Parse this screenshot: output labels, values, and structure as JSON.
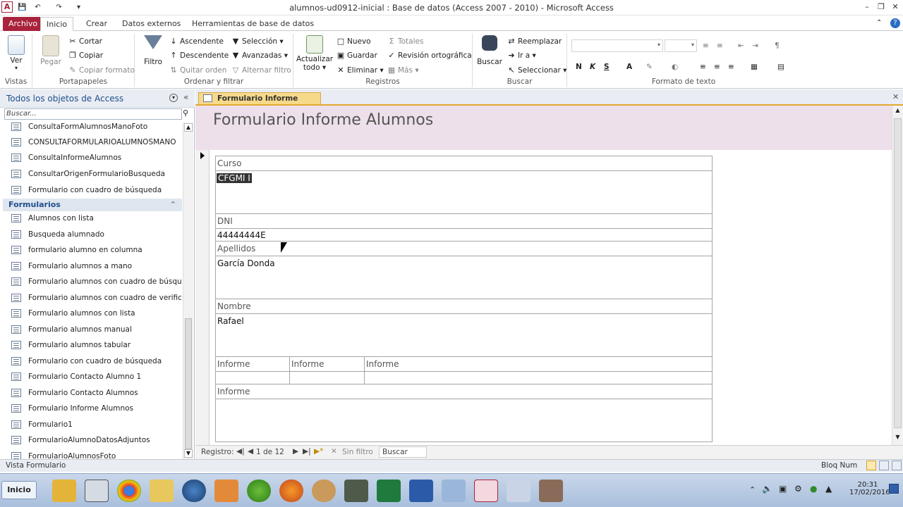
{
  "window": {
    "title": "alumnos-ud0912-inicial : Base de datos (Access 2007 - 2010)  -  Microsoft Access",
    "app_icon": "A",
    "controls": [
      "minimize-icon",
      "restore-icon",
      "close-icon"
    ]
  },
  "ribbon_tabs": [
    "Archivo",
    "Inicio",
    "Crear",
    "Datos externos",
    "Herramientas de base de datos"
  ],
  "ribbon": {
    "vistas": {
      "ver_label": "Ver",
      "group_label": "Vistas"
    },
    "portapapeles": {
      "pegar": "Pegar",
      "cortar": "Cortar",
      "copiar": "Copiar",
      "copiar_formato": "Copiar formato",
      "group_label": "Portapapeles"
    },
    "ordenar": {
      "filtro": "Filtro",
      "ascendente": "Ascendente",
      "descendente": "Descendente",
      "quitar_orden": "Quitar orden",
      "seleccion": "Selección",
      "avanzadas": "Avanzadas",
      "alternar_filtro": "Alternar filtro",
      "group_label": "Ordenar y filtrar"
    },
    "registros": {
      "actualizar_line1": "Actualizar",
      "actualizar_line2": "todo",
      "nuevo": "Nuevo",
      "guardar": "Guardar",
      "eliminar": "Eliminar",
      "totales": "Totales",
      "revision": "Revisión ortográfica",
      "mas": "Más",
      "group_label": "Registros"
    },
    "buscar": {
      "buscar": "Buscar",
      "reemplazar": "Reemplazar",
      "ir_a": "Ir a",
      "seleccionar": "Seleccionar",
      "group_label": "Buscar"
    },
    "formato": {
      "bold": "N",
      "italic": "K",
      "underline": "S",
      "group_label": "Formato de texto"
    }
  },
  "nav": {
    "title": "Todos los objetos de Access",
    "search_placeholder": "Buscar...",
    "queries": [
      "ConsultaFormAlumnosManoFoto",
      "CONSULTAFORMULARIOALUMNOSMANO",
      "ConsultaInformeAlumnos",
      "ConsultarOrigenFormularioBusqueda",
      "Formulario con cuadro de búsqueda"
    ],
    "group_label": "Formularios",
    "forms": [
      "Alumnos con lista",
      "Busqueda alumnado",
      "formulario alumno en columna",
      "Formulario alumnos a mano",
      "Formulario alumnos con cuadro de búsque...",
      "Formulario alumnos con cuadro de verific...",
      "Formulario alumnos con lista",
      "Formulario alumnos manual",
      "Formulario alumnos tabular",
      "Formulario con cuadro de búsqueda",
      "Formulario Contacto Alumno 1",
      "Formulario Contacto Alumnos",
      "Formulario Informe Alumnos",
      "Formulario1",
      "FormularioAlumnoDatosAdjuntos",
      "FormularioAlumnosFoto"
    ]
  },
  "document": {
    "tab_label": "Formulario Informe Alumnos",
    "form_title": "Formulario Informe Alumnos",
    "fields": {
      "curso_label": "Curso",
      "curso_value": "CFGMI I",
      "dni_label": "DNI",
      "dni_value": "44444444E",
      "apellidos_label": "Apellidos",
      "apellidos_value": "García Donda",
      "nombre_label": "Nombre",
      "nombre_value": "Rafael",
      "informe_cols": [
        "Informe",
        "Informe",
        "Informe"
      ],
      "informe_label": "Informe"
    }
  },
  "record_nav": {
    "label": "Registro:",
    "position": "1 de 12",
    "filter": "Sin filtro",
    "search": "Buscar"
  },
  "status": {
    "left": "Vista Formulario",
    "right": "Bloq Num"
  },
  "taskbar": {
    "start": "Inicio",
    "time": "20:31",
    "date": "17/02/2016"
  }
}
